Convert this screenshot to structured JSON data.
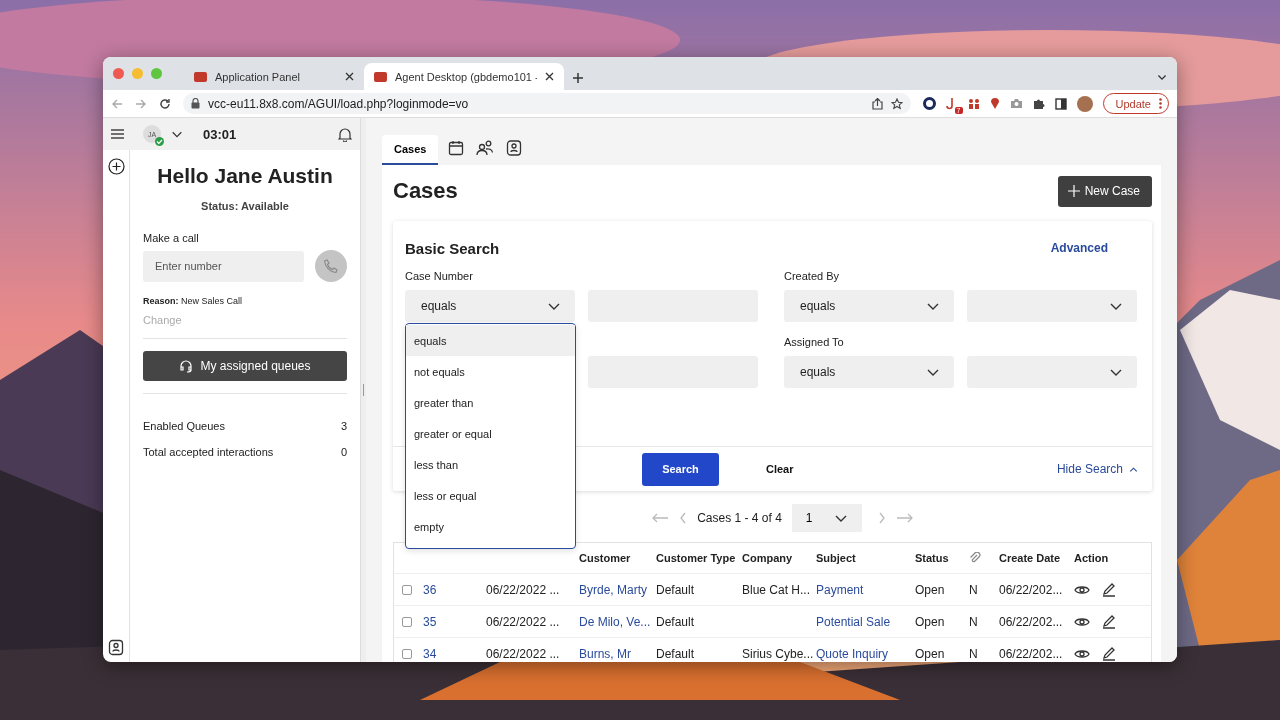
{
  "browser": {
    "tabs": [
      {
        "title": "Application Panel",
        "selected": false
      },
      {
        "title": "Agent Desktop (gbdemo101 -",
        "selected": true
      }
    ],
    "url": "vcc-eu11.8x8.com/AGUI/load.php?loginmode=vo",
    "extension_badge": "7",
    "update_button": "Update"
  },
  "agent_panel": {
    "avatar_initials": "JA",
    "timer": "03:01",
    "greeting": "Hello Jane Austin",
    "status": "Status: Available",
    "make_call_label": "Make a call",
    "number_placeholder": "Enter number",
    "reason": "**Reason:** New Sales Call",
    "change_link": "Change",
    "queues_button": "My assigned queues",
    "stats": [
      {
        "label": "Enabled Queues",
        "value": "3"
      },
      {
        "label": "Total accepted interactions",
        "value": "0"
      }
    ]
  },
  "workspace": {
    "tabs": [
      {
        "kind": "text",
        "label": "Cases",
        "selected": true
      },
      {
        "kind": "calendar",
        "selected": false
      },
      {
        "kind": "people",
        "selected": false
      },
      {
        "kind": "contact",
        "selected": false
      }
    ],
    "title": "Cases",
    "new_button": "New Case",
    "search": {
      "title": "Basic Search",
      "advanced_link": "Advanced",
      "fields": [
        {
          "label": "Case Number",
          "operator": "equals",
          "kind": "text"
        },
        {
          "label": "Created By",
          "operator": "equals",
          "kind": "select"
        },
        {
          "kind": "text"
        },
        {
          "label": "Assigned To",
          "operator": "equals",
          "kind": "select"
        }
      ],
      "dropdown_options": [
        {
          "label": "equals",
          "selected": true
        },
        {
          "label": "not equals",
          "selected": false
        },
        {
          "label": "greater than",
          "selected": false
        },
        {
          "label": "greater or equal",
          "selected": false
        },
        {
          "label": "less than",
          "selected": false
        },
        {
          "label": "less or equal",
          "selected": false
        },
        {
          "label": "empty",
          "selected": false
        }
      ],
      "search_button": "Search",
      "clear_button": "Clear",
      "hide_link": "Hide Search"
    },
    "pagination": {
      "summary": "Cases 1 - 4 of 4",
      "page": "1"
    },
    "table": {
      "columns": [
        {
          "kind": "hidden"
        },
        {
          "kind": "hidden"
        },
        {
          "kind": "hidden"
        },
        {
          "kind": "text",
          "label": "Customer"
        },
        {
          "kind": "text",
          "label": "Customer Type"
        },
        {
          "kind": "text",
          "label": "Company"
        },
        {
          "kind": "text",
          "label": "Subject"
        },
        {
          "kind": "text",
          "label": "Status"
        },
        {
          "kind": "attachment"
        },
        {
          "kind": "text",
          "label": "Create Date"
        },
        {
          "kind": "text",
          "label": "Action"
        }
      ],
      "rows": [
        {
          "checked": false,
          "case_number": "36",
          "updated": "06/22/2022 ...",
          "customer": "Byrde, Marty",
          "customer_type": "Default",
          "company": "Blue Cat H...",
          "subject": "Payment",
          "status": "Open",
          "attachment": "N",
          "created": "06/22/202..."
        },
        {
          "checked": false,
          "case_number": "35",
          "updated": "06/22/2022 ...",
          "customer": "De Milo, Ve...",
          "customer_type": "Default",
          "subject": "Potential Sale",
          "status": "Open",
          "attachment": "N",
          "created": "06/22/202..."
        },
        {
          "checked": false,
          "case_number": "34",
          "updated": "06/22/2022 ...",
          "customer": "Burns, Mr",
          "customer_type": "Default",
          "company": "Sirius Cybe...",
          "subject": "Quote Inquiry",
          "status": "Open",
          "attachment": "N",
          "created": "06/22/202..."
        }
      ]
    }
  }
}
